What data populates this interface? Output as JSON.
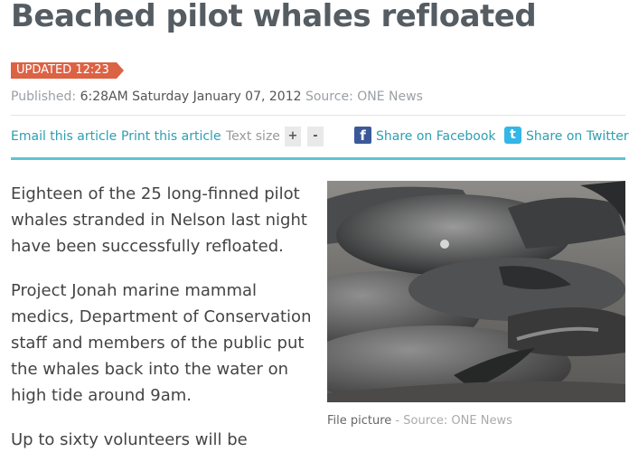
{
  "article": {
    "title": "Beached pilot whales refloated",
    "updated_badge": "UPDATED 12:23",
    "published_label": "Published:",
    "published_value": "6:28AM Saturday January 07, 2012",
    "source_label": "Source:",
    "source_value": "ONE News",
    "paragraphs": [
      "Eighteen of the 25 long-finned pilot whales stranded in Nelson last night have been successfully refloated.",
      "Project Jonah marine mammal medics, Department of Conservation staff and members of the public put the whales back into the water on high tide around 9am.",
      "Up to sixty volunteers will be"
    ]
  },
  "toolbar": {
    "email_label": "Email this article",
    "print_label": "Print this article",
    "text_size_label": "Text size",
    "increase_label": "+",
    "decrease_label": "-",
    "facebook_icon_glyph": "f",
    "facebook_label": "Share on Facebook",
    "twitter_icon_glyph": "t",
    "twitter_label": "Share on Twitter"
  },
  "image": {
    "description_icon": "whale-photo",
    "caption": "File picture",
    "caption_separator": " - ",
    "source": "Source: ONE News"
  },
  "colors": {
    "badge": "#dc6244",
    "link": "#2d9fb1",
    "rule": "#5fc3d2",
    "facebook": "#3b5998",
    "twitter": "#33b6e8"
  }
}
